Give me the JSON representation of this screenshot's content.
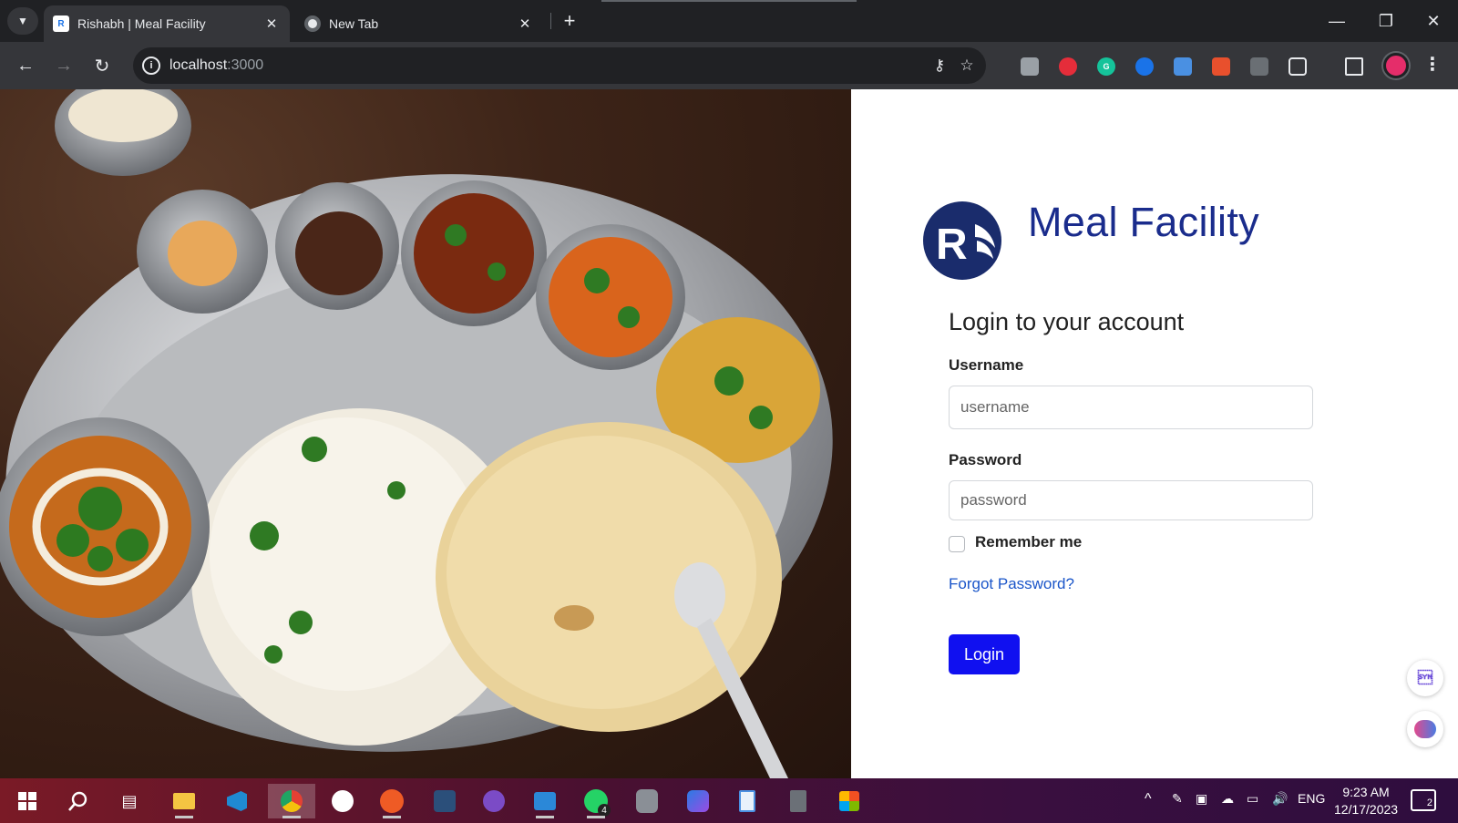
{
  "browser": {
    "tabs": [
      {
        "title": "Rishabh | Meal Facility",
        "active": true,
        "favicon": "rb-logo-icon"
      },
      {
        "title": "New Tab",
        "active": false,
        "favicon": "chrome-icon"
      }
    ],
    "url_host": "localhost",
    "url_port": ":3000"
  },
  "login": {
    "app_title": "Meal Facility",
    "heading": "Login to your account",
    "username_label": "Username",
    "username_placeholder": "username",
    "password_label": "Password",
    "password_placeholder": "password",
    "remember_label": "Remember me",
    "forgot_label": "Forgot Password?",
    "login_button": "Login"
  },
  "colors": {
    "brand_navy": "#1a2c8c",
    "button_blue": "#1010f0",
    "link_blue": "#1a55c9"
  },
  "taskbar": {
    "language": "ENG",
    "time": "9:23 AM",
    "date": "12/17/2023",
    "whatsapp_badge": "4",
    "notifications_count": "2"
  }
}
